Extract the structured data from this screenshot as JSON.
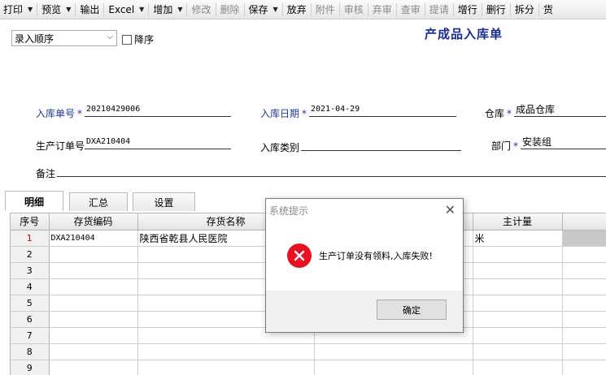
{
  "toolbar": {
    "items": [
      {
        "label": "打印",
        "dropdown": true,
        "disabled": false
      },
      {
        "label": "预览",
        "dropdown": true,
        "disabled": false
      },
      {
        "label": "输出",
        "dropdown": false,
        "disabled": false
      },
      {
        "label": "Excel",
        "dropdown": true,
        "disabled": false
      },
      {
        "label": "增加",
        "dropdown": true,
        "disabled": false
      },
      {
        "label": "修改",
        "dropdown": false,
        "disabled": true
      },
      {
        "label": "删除",
        "dropdown": false,
        "disabled": true
      },
      {
        "label": "保存",
        "dropdown": true,
        "disabled": false
      },
      {
        "label": "放弃",
        "dropdown": false,
        "disabled": false
      },
      {
        "label": "附件",
        "dropdown": false,
        "disabled": true
      },
      {
        "label": "审核",
        "dropdown": false,
        "disabled": true
      },
      {
        "label": "弃审",
        "dropdown": false,
        "disabled": true
      },
      {
        "label": "查审",
        "dropdown": false,
        "disabled": true
      },
      {
        "label": "提请",
        "dropdown": false,
        "disabled": true
      },
      {
        "label": "增行",
        "dropdown": false,
        "disabled": false
      },
      {
        "label": "删行",
        "dropdown": false,
        "disabled": false
      },
      {
        "label": "拆分",
        "dropdown": false,
        "disabled": false
      },
      {
        "label": "货",
        "dropdown": false,
        "disabled": false
      }
    ]
  },
  "header": {
    "order_select": "录入顺序",
    "desc_label": "降序",
    "title": "产成品入库单"
  },
  "form": {
    "receipt_no_label": "入库单号",
    "receipt_no": "20210429006",
    "receipt_date_label": "入库日期",
    "receipt_date": "2021-04-29",
    "warehouse_label": "仓库",
    "warehouse": "成品仓库",
    "prod_order_label": "生产订单号",
    "prod_order": "DXA210404",
    "receipt_type_label": "入库类别",
    "receipt_type": "",
    "dept_label": "部门",
    "dept": "安装组",
    "remark_label": "备注",
    "remark": "",
    "required_mark": "*"
  },
  "tabs": [
    "明细",
    "汇总",
    "设置"
  ],
  "grid": {
    "columns": [
      "序号",
      "存货编码",
      "存货名称",
      "",
      "主计量",
      ""
    ],
    "rows": [
      {
        "no": "1",
        "code": "DXA210404",
        "name": "陕西省乾县人民医院",
        "unit": "米"
      },
      {
        "no": "2",
        "code": "",
        "name": "",
        "unit": ""
      },
      {
        "no": "3",
        "code": "",
        "name": "",
        "unit": ""
      },
      {
        "no": "4",
        "code": "",
        "name": "",
        "unit": ""
      },
      {
        "no": "5",
        "code": "",
        "name": "",
        "unit": ""
      },
      {
        "no": "6",
        "code": "",
        "name": "",
        "unit": ""
      },
      {
        "no": "7",
        "code": "",
        "name": "",
        "unit": ""
      },
      {
        "no": "8",
        "code": "",
        "name": "",
        "unit": ""
      },
      {
        "no": "9",
        "code": "",
        "name": "",
        "unit": ""
      }
    ]
  },
  "dialog": {
    "title": "系统提示",
    "message": "生产订单没有领料,入库失败!",
    "ok_label": "确定",
    "icon": "error-icon"
  }
}
